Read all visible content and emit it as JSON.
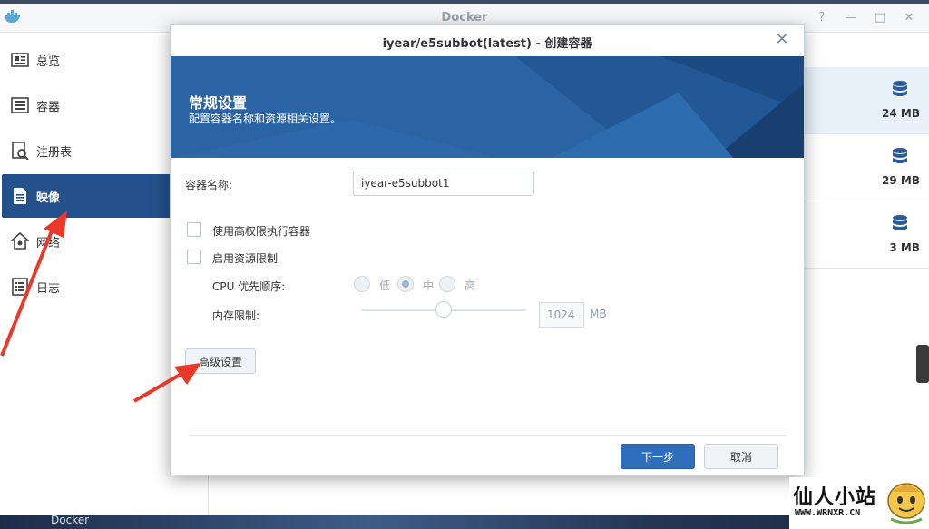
{
  "docker": {
    "title": "Docker",
    "controls": [
      "?",
      "—",
      "□",
      "✕"
    ],
    "sidebar": [
      {
        "label": "总览",
        "icon": "overview-icon"
      },
      {
        "label": "容器",
        "icon": "container-icon"
      },
      {
        "label": "注册表",
        "icon": "registry-icon"
      },
      {
        "label": "映像",
        "icon": "image-icon",
        "active": true
      },
      {
        "label": "网络",
        "icon": "network-icon"
      },
      {
        "label": "日志",
        "icon": "log-icon"
      }
    ],
    "image_sizes": [
      "24 MB",
      "29 MB",
      "3 MB"
    ],
    "taskbar_label": "Docker"
  },
  "dialog": {
    "title": "iyear/e5subbot(latest) - 创建容器",
    "banner_title": "常规设置",
    "banner_subtitle": "配置容器名称和资源相关设置。",
    "container_name_label": "容器名称:",
    "container_name_value": "iyear-e5subbot1",
    "privileged_label": "使用高权限执行容器",
    "resource_limit_label": "启用资源限制",
    "cpu_label": "CPU 优先顺序:",
    "cpu_options": [
      "低",
      "中",
      "高"
    ],
    "cpu_selected": "中",
    "memory_label": "内存限制:",
    "memory_value": "1024",
    "memory_unit": "MB",
    "advanced_button": "高级设置",
    "next_button": "下一步",
    "cancel_button": "取消"
  },
  "watermark": {
    "title": "仙人小站",
    "url": "WWW.WRNXR.CN"
  },
  "colors": {
    "accent": "#24508b",
    "banner": "#2b64a4",
    "primary_button": "#2f6dbd",
    "annotation_arrow": "#e8392a"
  }
}
